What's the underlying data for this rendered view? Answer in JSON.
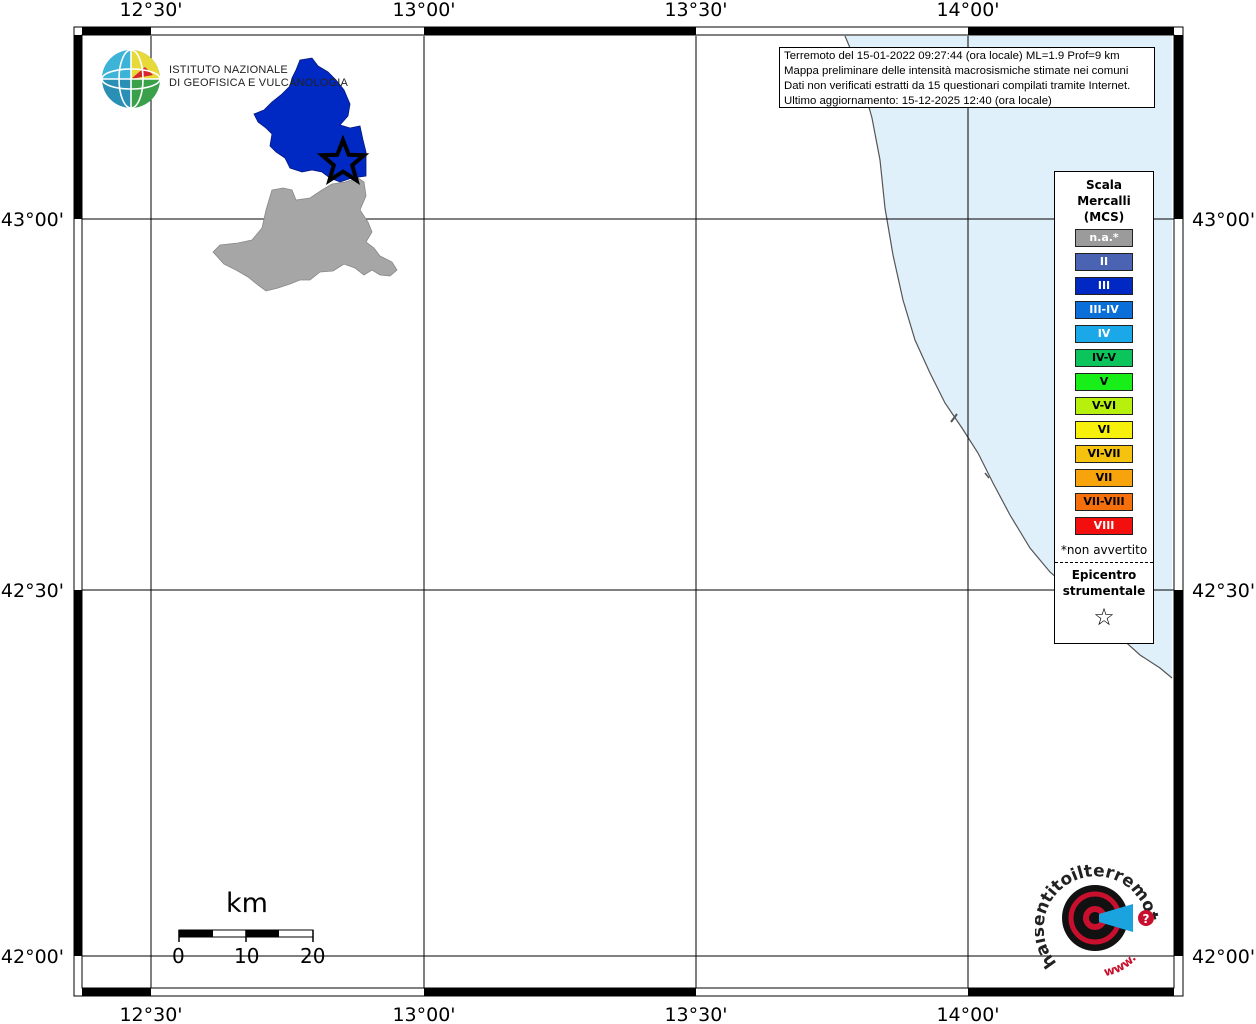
{
  "map": {
    "lon_labels": [
      "12°30'",
      "13°00'",
      "13°30'",
      "14°00'"
    ],
    "lat_labels": [
      "43°00'",
      "42°30'",
      "42°00'"
    ]
  },
  "info": {
    "line1": "Terremoto del 15-01-2022 09:27:44 (ora locale) ML=1.9 Prof=9 km",
    "line2": "Mappa preliminare delle intensità macrosismiche stimate nei comuni",
    "line3": "Dati non verificati estratti da 15 questionari compilati tramite Internet.",
    "line4": "Ultimo aggiornamento: 15-12-2025 12:40 (ora locale)"
  },
  "institute": {
    "line1": "ISTITUTO NAZIONALE",
    "line2": "DI GEOFISICA E VULCANOLOGIA"
  },
  "legend": {
    "title1": "Scala",
    "title2": "Mercalli",
    "title3": "(MCS)",
    "items": [
      {
        "label": "n.a.*",
        "color": "#9b9b9b",
        "text_color": "#ffffff"
      },
      {
        "label": "II",
        "color": "#4a63b3",
        "text_color": "#ffffff"
      },
      {
        "label": "III",
        "color": "#0029c4",
        "text_color": "#ffffff"
      },
      {
        "label": "III-IV",
        "color": "#0a6fd9",
        "text_color": "#ffffff"
      },
      {
        "label": "IV",
        "color": "#1aa8e8",
        "text_color": "#ffffff"
      },
      {
        "label": "IV-V",
        "color": "#0bc45c",
        "text_color": "#000000"
      },
      {
        "label": "V",
        "color": "#18ee18",
        "text_color": "#000000"
      },
      {
        "label": "V-VI",
        "color": "#b7f00c",
        "text_color": "#000000"
      },
      {
        "label": "VI",
        "color": "#f6f00a",
        "text_color": "#000000"
      },
      {
        "label": "VI-VII",
        "color": "#f5c30d",
        "text_color": "#000000"
      },
      {
        "label": "VII",
        "color": "#f7a30c",
        "text_color": "#000000"
      },
      {
        "label": "VII-VIII",
        "color": "#f5700b",
        "text_color": "#000000"
      },
      {
        "label": "VIII",
        "color": "#f40f0f",
        "text_color": "#ffffff"
      }
    ],
    "note": "*non avvertito",
    "epicenter1": "Epicentro",
    "epicenter2": "strumentale",
    "star": "☆"
  },
  "scale": {
    "unit": "km",
    "labels": [
      "0",
      "10",
      "20"
    ]
  },
  "logo": {
    "arc_text": "haisentitoilterremoto.it",
    "url_text": "www.",
    "question": "?"
  },
  "colors": {
    "sea": "#dff0fb",
    "intensity_iii": "#0029c4",
    "not_felt": "#a6a6a6"
  }
}
